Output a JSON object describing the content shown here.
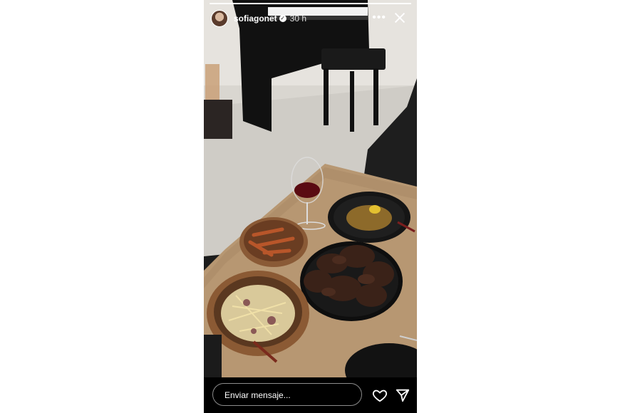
{
  "story": {
    "username": "sofiagonet",
    "time_ago": "30 h",
    "progress": 1.0
  },
  "footer": {
    "message_placeholder": "Enviar mensaje..."
  },
  "icons": {
    "more": "more-options-icon",
    "close": "close-icon",
    "like": "heart-icon",
    "share": "paper-plane-icon",
    "verified": "verified-badge-icon"
  }
}
